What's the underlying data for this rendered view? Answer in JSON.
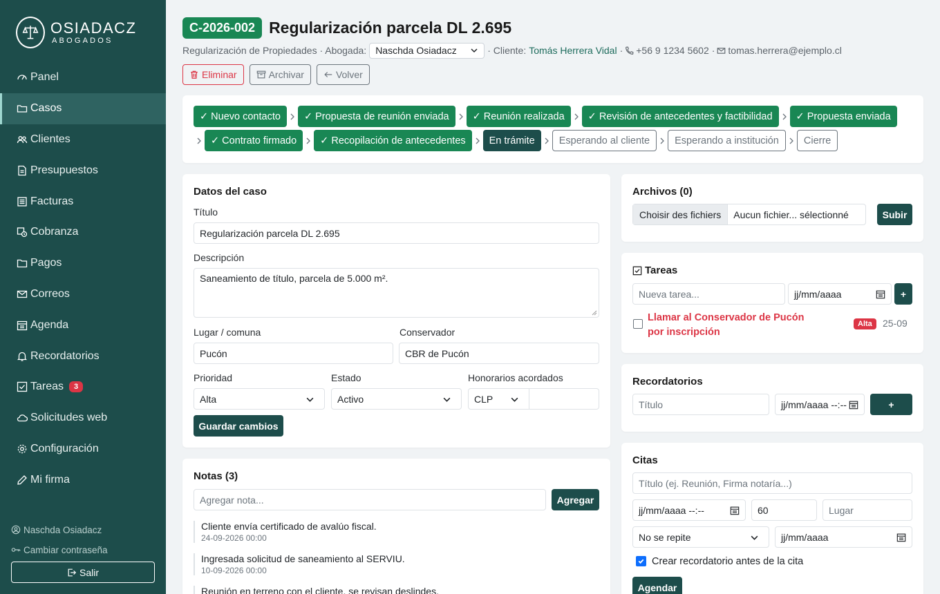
{
  "brand": {
    "name": "OSIADACZ",
    "subtitle": "ABOGADOS"
  },
  "nav": [
    {
      "label": "Panel",
      "icon": "speedometer-icon"
    },
    {
      "label": "Casos",
      "icon": "folder-open-icon",
      "active": true
    },
    {
      "label": "Clientes",
      "icon": "people-icon"
    },
    {
      "label": "Presupuestos",
      "icon": "file-text-icon"
    },
    {
      "label": "Facturas",
      "icon": "receipt-icon"
    },
    {
      "label": "Cobranza",
      "icon": "cash-clock-icon"
    },
    {
      "label": "Pagos",
      "icon": "folder-icon"
    },
    {
      "label": "Correos",
      "icon": "envelope-icon"
    },
    {
      "label": "Agenda",
      "icon": "calendar-icon"
    },
    {
      "label": "Recordatorios",
      "icon": "bell-icon"
    },
    {
      "label": "Tareas",
      "icon": "check-square-icon",
      "badge": "3"
    },
    {
      "label": "Solicitudes web",
      "icon": "cloud-icon"
    },
    {
      "label": "Configuración",
      "icon": "gear-icon"
    },
    {
      "label": "Mi firma",
      "icon": "pen-icon"
    }
  ],
  "footer": {
    "user": "Naschda Osiadacz",
    "change_password": "Cambiar contraseña",
    "logout": "Salir"
  },
  "case": {
    "code": "C-2026-002",
    "title": "Regularización parcela DL 2.695",
    "type_prefix": "Regularización de Propiedades · Abogada:",
    "lawyer": "Naschda Osiadacz",
    "client_prefix": "· Cliente:",
    "client": "Tomás Herrera Vidal",
    "sep": "·",
    "phone": "+56 9 1234 5602",
    "email": "tomas.herrera@ejemplo.cl"
  },
  "actions": {
    "delete": "Eliminar",
    "archive": "Archivar",
    "back": "Volver"
  },
  "stages_row1": [
    {
      "label": "✓ Nuevo contacto",
      "state": "done"
    },
    {
      "label": "✓ Propuesta de reunión enviada",
      "state": "done"
    },
    {
      "label": "✓ Reunión realizada",
      "state": "done"
    },
    {
      "label": "✓ Revisión de antecedentes y factibilidad",
      "state": "done"
    },
    {
      "label": "✓ Propuesta enviada",
      "state": "done"
    }
  ],
  "stages_row2": [
    {
      "label": "✓ Contrato firmado",
      "state": "done"
    },
    {
      "label": "✓ Recopilación de antecedentes",
      "state": "done"
    },
    {
      "label": "En trámite",
      "state": "current"
    },
    {
      "label": "Esperando al cliente",
      "state": "pending"
    },
    {
      "label": "Esperando a institución",
      "state": "pending"
    },
    {
      "label": "Cierre",
      "state": "pending"
    }
  ],
  "datos": {
    "title": "Datos del caso",
    "titulo_label": "Título",
    "titulo_value": "Regularización parcela DL 2.695",
    "descripcion_label": "Descripción",
    "descripcion_value": "Saneamiento de título, parcela de 5.000 m².",
    "lugar_label": "Lugar / comuna",
    "lugar_value": "Pucón",
    "conservador_label": "Conservador",
    "conservador_value": "CBR de Pucón",
    "prioridad_label": "Prioridad",
    "prioridad_value": "Alta",
    "estado_label": "Estado",
    "estado_value": "Activo",
    "honorarios_label": "Honorarios acordados",
    "currency_value": "CLP",
    "amount_value": "",
    "save": "Guardar cambios"
  },
  "notas": {
    "title": "Notas (3)",
    "placeholder": "Agregar nota...",
    "add": "Agregar",
    "items": [
      {
        "text": "Cliente envía certificado de avalúo fiscal.",
        "date": "24-09-2026 00:00"
      },
      {
        "text": "Ingresada solicitud de saneamiento al SERVIU.",
        "date": "10-09-2026 00:00"
      },
      {
        "text": "Reunión en terreno con el cliente, se revisan deslindes.",
        "date": ""
      }
    ]
  },
  "archivos": {
    "title": "Archivos (0)",
    "choose": "Choisir des fichiers",
    "none": "Aucun fichier... sélectionné",
    "upload": "Subir"
  },
  "tareas": {
    "title": "Tareas",
    "placeholder": "Nueva tarea...",
    "date_placeholder": "jj/mm/aaaa",
    "add": "+",
    "item": {
      "text": "Llamar al Conservador de Pucón por inscripción",
      "priority": "Alta",
      "date": "25-09"
    }
  },
  "recordatorios": {
    "title": "Recordatorios",
    "placeholder": "Título",
    "datetime_placeholder": "jj/mm/aaaa --:--",
    "add": "+"
  },
  "citas": {
    "title": "Citas",
    "title_placeholder": "Título (ej. Reunión, Firma notaría...)",
    "datetime_placeholder": "jj/mm/aaaa --:--",
    "duration": "60",
    "place_placeholder": "Lugar",
    "repeat": "No se repite",
    "until_placeholder": "jj/mm/aaaa",
    "reminder_label": "Crear recordatorio antes de la cita",
    "submit": "Agendar"
  },
  "colors": {
    "sidebar": "#1d4d4b",
    "done": "#198754",
    "danger": "#dc3545",
    "primary_check": "#0d6efd"
  }
}
